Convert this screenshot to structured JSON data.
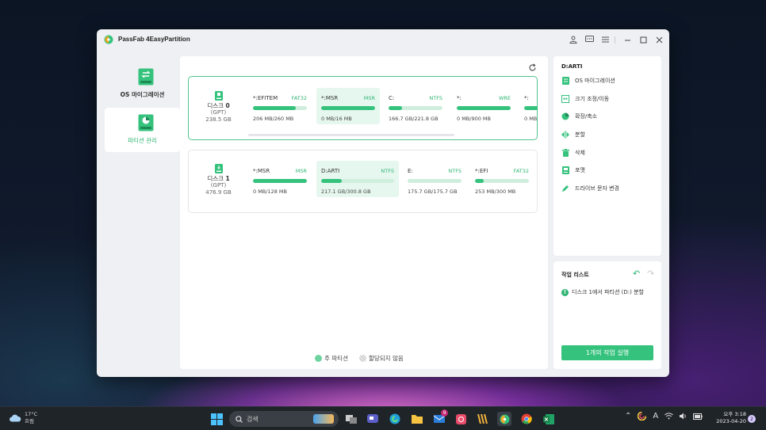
{
  "app": {
    "title": "PassFab 4EasyPartition",
    "brand_color": "#34c27c"
  },
  "sidebar": {
    "items": [
      {
        "label": "OS 마이그레이션",
        "icon": "os-migration-icon"
      },
      {
        "label": "파티션 관리",
        "icon": "partition-management-icon",
        "selected": true
      }
    ]
  },
  "disks": [
    {
      "name": "디스크",
      "number": "0",
      "style": "(GPT)",
      "size": "238.5 GB",
      "partitions": [
        {
          "name": "*:EFITEM",
          "type": "FAT32",
          "size": "206 MB/260 MB",
          "used_fraction": 0.79
        },
        {
          "name": "*:MSR",
          "type": "MSR",
          "size": "0 MB/16 MB",
          "used_fraction": 1.0
        },
        {
          "name": "C:",
          "type": "NTFS",
          "size": "166.7 GB/221.8 GB",
          "used_fraction": 0.25
        },
        {
          "name": "*:",
          "type": "WRE",
          "size": "0 MB/900 MB",
          "used_fraction": 1.0
        },
        {
          "name": "*:",
          "type": "",
          "size": "0 MB",
          "used_fraction": 1.0
        }
      ]
    },
    {
      "name": "디스크",
      "number": "1",
      "style": "(GPT)",
      "size": "476.9 GB",
      "partitions": [
        {
          "name": "*:MSR",
          "type": "MSR",
          "size": "0 MB/128 MB",
          "used_fraction": 1.0
        },
        {
          "name": "D:ARTI",
          "type": "NTFS",
          "size": "217.1 GB/300.8 GB",
          "used_fraction": 0.28
        },
        {
          "name": "E:",
          "type": "NTFS",
          "size": "175.7 GB/175.7 GB",
          "used_fraction": 0.0
        },
        {
          "name": "*:EFI",
          "type": "FAT32",
          "size": "253 MB/300 MB",
          "used_fraction": 0.16
        }
      ]
    }
  ],
  "legend": {
    "primary": "주 파티션",
    "unallocated": "할당되지 않음"
  },
  "operations": {
    "title": "D:ARTI",
    "items": [
      {
        "label": "OS 마이그레이션",
        "icon": "os-migration-icon"
      },
      {
        "label": "크기 조정/이동",
        "icon": "resize-move-icon"
      },
      {
        "label": "확장/축소",
        "icon": "extend-shrink-icon"
      },
      {
        "label": "분할",
        "icon": "split-icon"
      },
      {
        "label": "삭제",
        "icon": "trash-icon"
      },
      {
        "label": "포맷",
        "icon": "format-icon"
      },
      {
        "label": "드라이브 문자 변경",
        "icon": "pencil-icon"
      }
    ]
  },
  "tasks": {
    "title": "작업 리스트",
    "item": "디스크 1에서 파티션 (D:) 분할",
    "run_button": "1개의 작업 실행"
  },
  "taskbar": {
    "weather_temp": "17°C",
    "weather_desc": "흐림",
    "search_placeholder": "검색",
    "mail_badge": "9",
    "time": "오후 3:18",
    "date": "2023-04-20",
    "notification_count": "2",
    "ime": "A"
  }
}
